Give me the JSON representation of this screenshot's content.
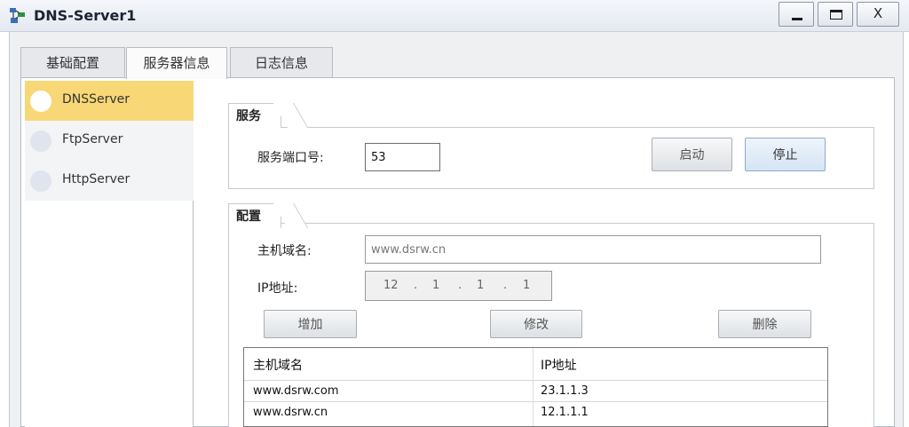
{
  "window": {
    "title": "DNS-Server1",
    "close_label": "X"
  },
  "tabs": [
    {
      "label": "基础配置"
    },
    {
      "label": "服务器信息"
    },
    {
      "label": "日志信息"
    }
  ],
  "servers": [
    {
      "label": "DNSServer"
    },
    {
      "label": "FtpServer"
    },
    {
      "label": "HttpServer"
    }
  ],
  "service": {
    "group_title": "服务",
    "port_label": "服务端口号:",
    "port_value": "53",
    "start_label": "启动",
    "stop_label": "停止"
  },
  "config": {
    "group_title": "配置",
    "host_label": "主机域名:",
    "host_value": "www.dsrw.cn",
    "ip_label": "IP地址:",
    "ip_octets": [
      "12",
      "1",
      "1",
      "1"
    ],
    "ip_dot": ".",
    "add_label": "增加",
    "modify_label": "修改",
    "delete_label": "删除"
  },
  "table": {
    "headers": [
      "主机域名",
      "IP地址"
    ],
    "rows": [
      {
        "host": "www.dsrw.com",
        "ip": "23.1.1.3"
      },
      {
        "host": "www.dsrw.cn",
        "ip": "12.1.1.1"
      }
    ]
  }
}
